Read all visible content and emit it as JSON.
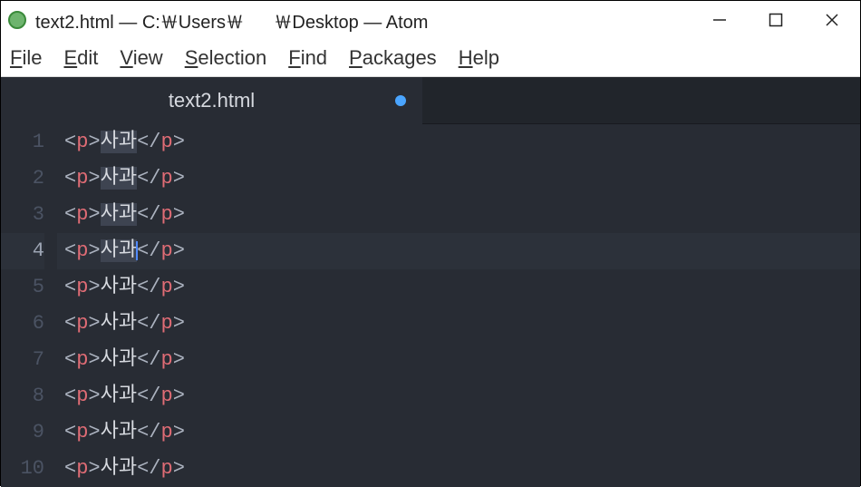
{
  "window": {
    "title": "text2.html — C:￦Users￦      ￦Desktop — Atom"
  },
  "menu": {
    "file": {
      "label": "File",
      "uindex": 0
    },
    "edit": {
      "label": "Edit",
      "uindex": 0
    },
    "view": {
      "label": "View",
      "uindex": 0
    },
    "selection": {
      "label": "Selection",
      "uindex": 0
    },
    "find": {
      "label": "Find",
      "uindex": 0
    },
    "packages": {
      "label": "Packages",
      "uindex": 0
    },
    "help": {
      "label": "Help",
      "uindex": 0
    }
  },
  "tab": {
    "label": "text2.html",
    "modified": true
  },
  "code": {
    "lines": [
      {
        "n": 1,
        "tag": "p",
        "text": "사과",
        "selected": true,
        "cursor": false,
        "active": false
      },
      {
        "n": 2,
        "tag": "p",
        "text": "사과",
        "selected": true,
        "cursor": false,
        "active": false
      },
      {
        "n": 3,
        "tag": "p",
        "text": "사과",
        "selected": true,
        "cursor": false,
        "active": false
      },
      {
        "n": 4,
        "tag": "p",
        "text": "사과",
        "selected": true,
        "cursor": true,
        "active": true
      },
      {
        "n": 5,
        "tag": "p",
        "text": "사과",
        "selected": false,
        "cursor": false,
        "active": false
      },
      {
        "n": 6,
        "tag": "p",
        "text": "사과",
        "selected": false,
        "cursor": false,
        "active": false
      },
      {
        "n": 7,
        "tag": "p",
        "text": "사과",
        "selected": false,
        "cursor": false,
        "active": false
      },
      {
        "n": 8,
        "tag": "p",
        "text": "사과",
        "selected": false,
        "cursor": false,
        "active": false
      },
      {
        "n": 9,
        "tag": "p",
        "text": "사과",
        "selected": false,
        "cursor": false,
        "active": false
      },
      {
        "n": 10,
        "tag": "p",
        "text": "사과",
        "selected": false,
        "cursor": false,
        "active": false
      }
    ]
  }
}
